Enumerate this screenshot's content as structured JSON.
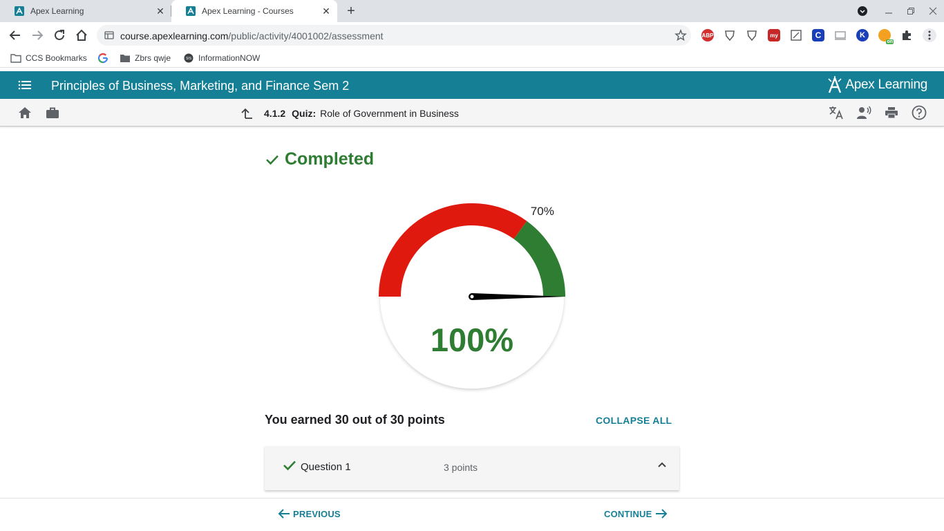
{
  "browser": {
    "tabs": [
      {
        "title": "Apex Learning",
        "active": false
      },
      {
        "title": "Apex Learning - Courses",
        "active": true
      }
    ],
    "url_host": "course.apexlearning.com",
    "url_path": "/public/activity/4001002/assessment",
    "extensions": [
      {
        "name": "ABP",
        "color": "#d32f2f"
      },
      {
        "name": "shield",
        "color": "#5f6368"
      },
      {
        "name": "shield-2",
        "color": "#5f6368"
      },
      {
        "name": "my",
        "color": "#c62828"
      },
      {
        "name": "sheets",
        "color": "#5f6368"
      },
      {
        "name": "C",
        "color": "#1a3fb8"
      },
      {
        "name": "cast",
        "color": "#9aa0a6"
      },
      {
        "name": "K",
        "color": "#1a3fb8"
      },
      {
        "name": "on",
        "color": "#f4a020"
      }
    ],
    "bookmarks": [
      {
        "label": "CCS Bookmarks",
        "icon": "folder-icon"
      },
      {
        "label": "",
        "icon": "google-icon"
      },
      {
        "label": "Zbrs qwje",
        "icon": "folder-icon"
      },
      {
        "label": "InformationNOW",
        "icon": "sis-icon"
      }
    ]
  },
  "header": {
    "course_title": "Principles of Business, Marketing, and Finance Sem 2",
    "logo_text": "Apex Learning"
  },
  "activity": {
    "number": "4.1.2",
    "type": "Quiz:",
    "title": "Role of Government in Business"
  },
  "result": {
    "status": "Completed",
    "threshold_label": "70%",
    "threshold_fraction": 0.7,
    "score_label": "100%",
    "score_fraction": 1.0,
    "summary": "You earned 30 out of 30 points",
    "collapse_label": "COLLAPSE ALL"
  },
  "questions": [
    {
      "label": "Question 1",
      "points": "3 points",
      "correct": true
    }
  ],
  "footer": {
    "previous_label": "PREVIOUS",
    "continue_label": "CONTINUE"
  },
  "colors": {
    "accent": "#157f95",
    "gauge_fail": "#e0190f",
    "gauge_pass": "#2e7d32"
  }
}
